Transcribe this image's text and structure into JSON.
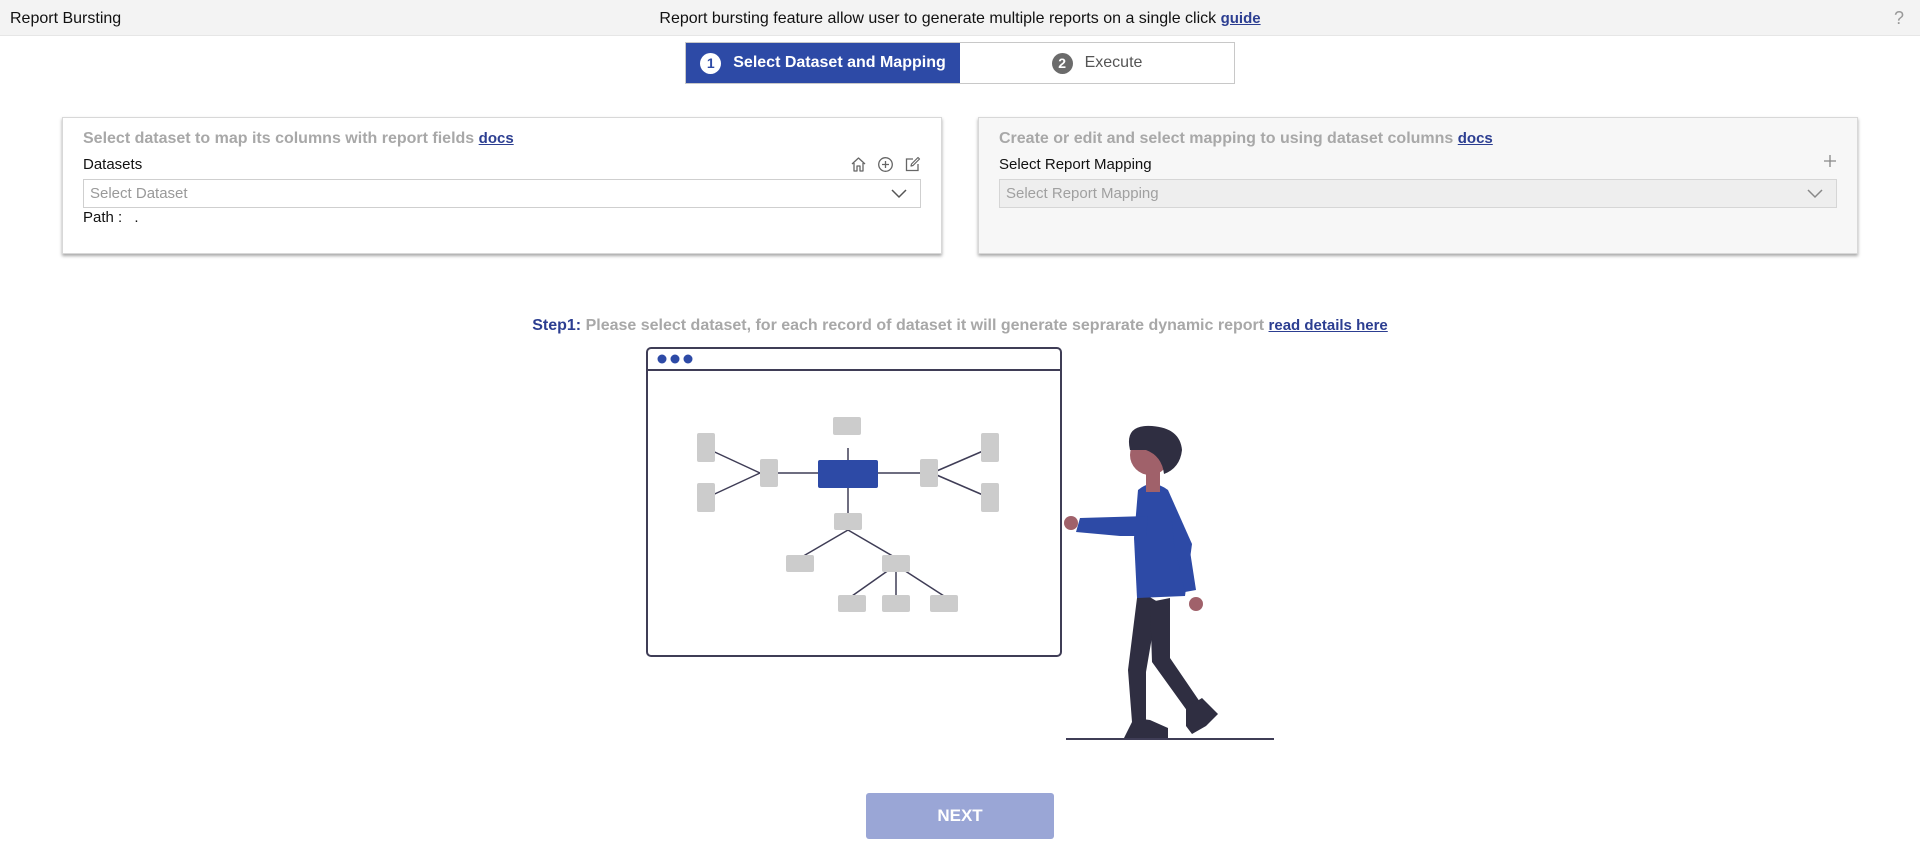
{
  "header": {
    "title": "Report Bursting",
    "info": "Report bursting feature allow user to generate multiple reports on a single click",
    "guide_link": "guide",
    "help": "?"
  },
  "stepper": [
    {
      "num": "1",
      "label": "Select Dataset and Mapping",
      "active": true
    },
    {
      "num": "2",
      "label": "Execute",
      "active": false
    }
  ],
  "dataset_panel": {
    "title": "Select dataset to map its columns with report fields",
    "docs_link": "docs",
    "label": "Datasets",
    "placeholder": "Select Dataset",
    "path_label": "Path :",
    "path_value": "."
  },
  "mapping_panel": {
    "title": "Create or edit and select mapping to using dataset columns",
    "docs_link": "docs",
    "label": "Select Report Mapping",
    "placeholder": "Select Report Mapping"
  },
  "step1": {
    "label": "Step1:",
    "text": "Please select dataset, for each record of dataset it will generate seprarate dynamic report",
    "link": "read details here"
  },
  "next_button": "NEXT",
  "colors": {
    "primary": "#2d4aa6",
    "link": "#2c3e91",
    "disabled_button": "#9aa6d6",
    "muted_text": "#a8a8a8"
  },
  "icons": [
    "home-icon",
    "add-circle-icon",
    "edit-icon",
    "plus-icon",
    "chevron-down-icon",
    "help-icon"
  ]
}
